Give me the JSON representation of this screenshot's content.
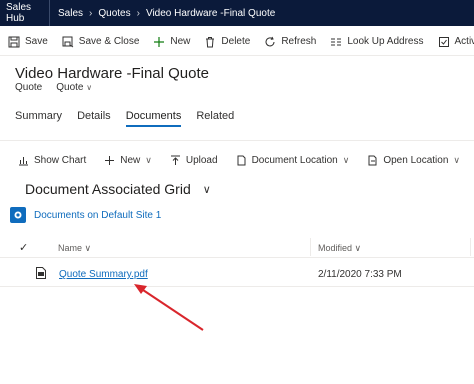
{
  "topbar": {
    "app_name": "Sales Hub",
    "breadcrumb": [
      "Sales",
      "Quotes",
      "Video Hardware -Final Quote"
    ]
  },
  "commands": [
    {
      "label": "Save",
      "icon": "save-icon"
    },
    {
      "label": "Save & Close",
      "icon": "save-close-icon"
    },
    {
      "label": "New",
      "icon": "plus-icon"
    },
    {
      "label": "Delete",
      "icon": "trash-icon"
    },
    {
      "label": "Refresh",
      "icon": "refresh-icon"
    },
    {
      "label": "Look Up Address",
      "icon": "lookup-address-icon"
    },
    {
      "label": "Activate Quote",
      "icon": "activate-icon"
    }
  ],
  "record": {
    "title": "Video Hardware -Final Quote",
    "entity": "Quote",
    "form": "Quote"
  },
  "tabs": [
    "Summary",
    "Details",
    "Documents",
    "Related"
  ],
  "active_tab": "Documents",
  "doc_toolbar": {
    "show_chart": "Show Chart",
    "new": "New",
    "upload": "Upload",
    "document_location": "Document Location",
    "open_location": "Open Location"
  },
  "grid": {
    "title": "Document Associated Grid",
    "site": "Documents on Default Site 1",
    "columns": {
      "name": "Name",
      "modified": "Modified"
    },
    "rows": [
      {
        "name": "Quote Summary.pdf",
        "modified": "2/11/2020 7:33 PM"
      }
    ]
  },
  "colors": {
    "topbar": "#0b1a3a",
    "accent": "#0f6cbd",
    "annotation_arrow": "#d9262c"
  }
}
